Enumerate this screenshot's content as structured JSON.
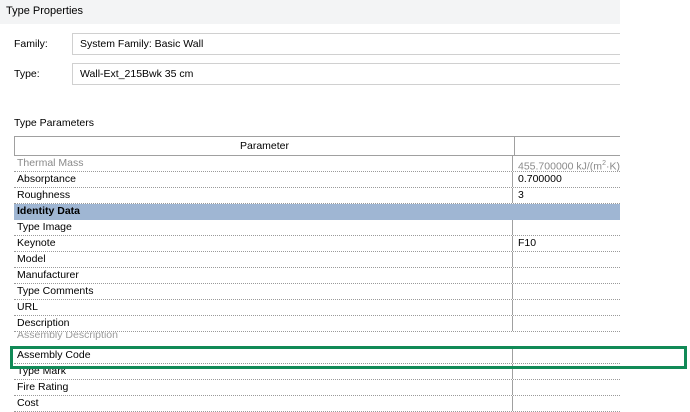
{
  "dialog": {
    "title": "Type Properties"
  },
  "family": {
    "label": "Family:",
    "value": "System Family: Basic Wall"
  },
  "type": {
    "label": "Type:",
    "value": "Wall-Ext_215Bwk 35 cm"
  },
  "type_parameters": {
    "label": "Type Parameters",
    "column_header": "Parameter",
    "rows": [
      {
        "name": "Thermal Mass",
        "value_prefix": "455.700000 kJ/(m",
        "value_sup": "2",
        "value_suffix": "·K)"
      },
      {
        "name": "Absorptance",
        "value": "0.700000"
      },
      {
        "name": "Roughness",
        "value": "3"
      },
      {
        "name": "Identity Data"
      },
      {
        "name": "Type Image",
        "value": ""
      },
      {
        "name": "Keynote",
        "value": "F10"
      },
      {
        "name": "Model",
        "value": ""
      },
      {
        "name": "Manufacturer",
        "value": ""
      },
      {
        "name": "Type Comments",
        "value": ""
      },
      {
        "name": "URL",
        "value": ""
      },
      {
        "name": "Description",
        "value": ""
      },
      {
        "name": "Assembly Description"
      },
      {
        "name": "Assembly Code",
        "value": ""
      },
      {
        "name": "Type Mark",
        "value": ""
      },
      {
        "name": "Fire Rating",
        "value": ""
      },
      {
        "name": "Cost",
        "value": ""
      }
    ]
  },
  "highlight": {
    "color": "#128a57"
  }
}
